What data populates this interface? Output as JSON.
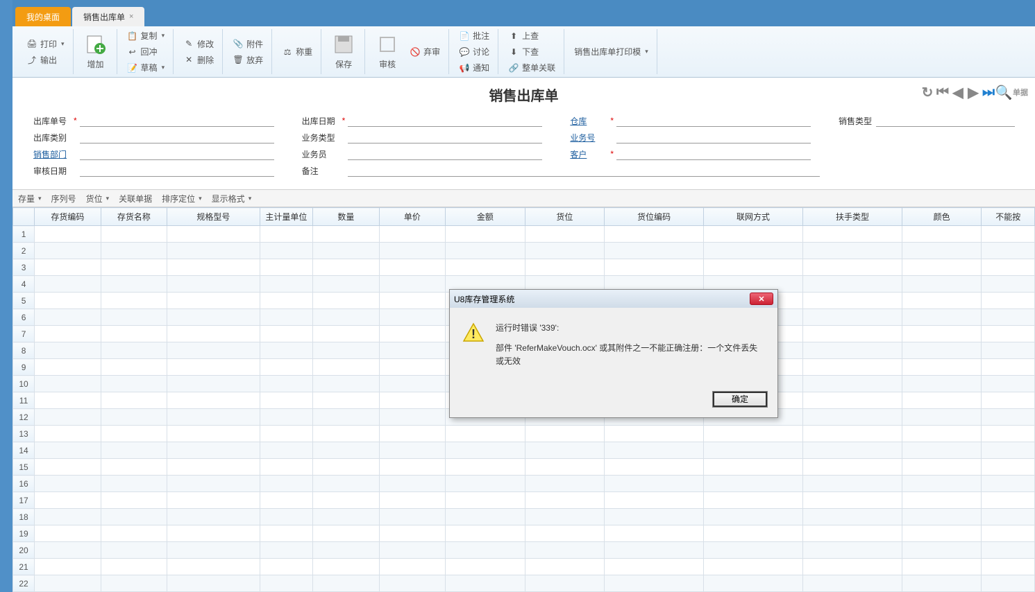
{
  "tabs": {
    "desktop": "我的桌面",
    "current": "销售出库单"
  },
  "ribbon": {
    "print": "打印",
    "output": "输出",
    "add": "增加",
    "copy": "复制",
    "reverse": "回冲",
    "draft": "草稿",
    "modify": "修改",
    "delete": "删除",
    "attachment": "附件",
    "abandon": "放弃",
    "weigh": "称重",
    "save": "保存",
    "audit": "审核",
    "reject": "弃审",
    "batch": "批注",
    "discuss": "讨论",
    "notify": "通知",
    "up": "上查",
    "down": "下查",
    "relate": "整单关联",
    "print_template": "销售出库单打印模"
  },
  "doc": {
    "title": "销售出库单",
    "search_placeholder": "单据"
  },
  "form": {
    "out_no": "出库单号",
    "out_type": "出库类别",
    "sales_dept": "销售部门",
    "audit_date": "审核日期",
    "out_date": "出库日期",
    "biz_type": "业务类型",
    "salesperson": "业务员",
    "remark": "备注",
    "warehouse": "仓库",
    "biz_no": "业务号",
    "customer": "客户",
    "sales_type": "销售类型"
  },
  "toolbar2": {
    "stock": "存量",
    "serial": "序列号",
    "location": "货位",
    "related": "关联单据",
    "sort": "排序定位",
    "display": "显示格式"
  },
  "grid": {
    "headers": [
      "",
      "存货编码",
      "存货名称",
      "规格型号",
      "主计量单位",
      "数量",
      "单价",
      "金额",
      "货位",
      "货位编码",
      "联网方式",
      "扶手类型",
      "颜色",
      "不能按"
    ],
    "widths": [
      32,
      100,
      100,
      140,
      80,
      100,
      100,
      120,
      120,
      150,
      150,
      150,
      120,
      80
    ],
    "rows": 22
  },
  "dialog": {
    "title": "U8库存管理系统",
    "line1": "运行时错误 '339':",
    "line2": "部件 'ReferMakeVouch.ocx' 或其附件之一不能正确注册：一个文件丢失或无效",
    "ok": "确定"
  }
}
